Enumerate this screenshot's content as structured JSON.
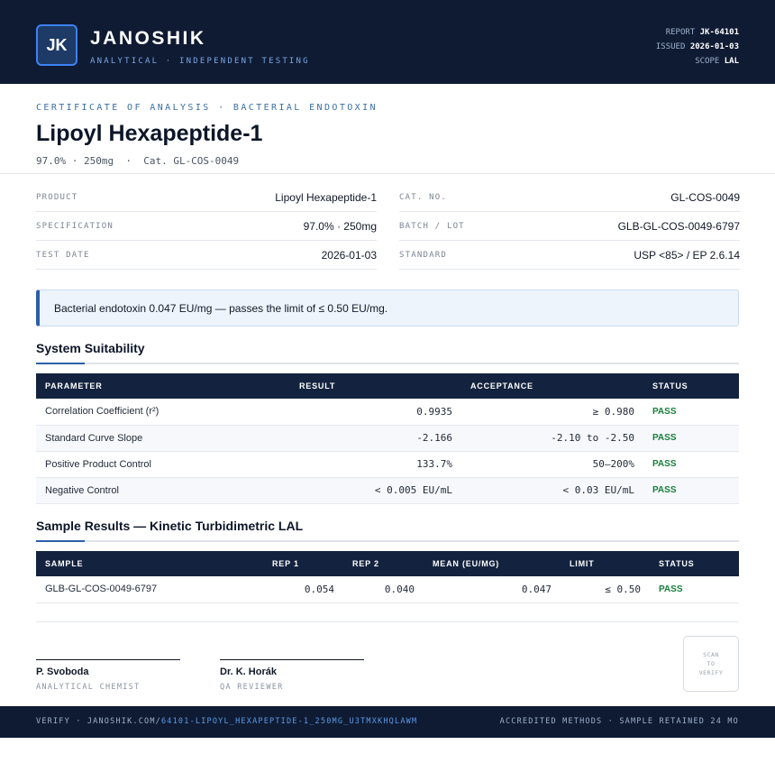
{
  "header": {
    "logo_text": "JK",
    "brand_name": "JANOSHIK",
    "tagline": "ANALYTICAL · INDEPENDENT TESTING",
    "report_label": "REPORT",
    "report_value": "JK-64101",
    "issued_label": "ISSUED",
    "issued_value": "2026-01-03",
    "scope_label": "SCOPE",
    "scope_value": "LAL"
  },
  "doc": {
    "kicker": "CERTIFICATE OF ANALYSIS · BACTERIAL ENDOTOXIN",
    "title": "Lipoyl Hexapeptide-1",
    "subtitle": "97.0% · 250mg  ·  Cat. GL-COS-0049"
  },
  "info": {
    "left": [
      {
        "label": "PRODUCT",
        "value": "Lipoyl Hexapeptide-1"
      },
      {
        "label": "SPECIFICATION",
        "value": "97.0% · 250mg"
      },
      {
        "label": "TEST DATE",
        "value": "2026-01-03"
      }
    ],
    "right": [
      {
        "label": "CAT. NO.",
        "value": "GL-COS-0049"
      },
      {
        "label": "BATCH / LOT",
        "value": "GLB-GL-COS-0049-6797"
      },
      {
        "label": "STANDARD",
        "value": "USP <85> / EP 2.6.14"
      }
    ]
  },
  "notice": "Bacterial endotoxin 0.047 EU/mg — passes the limit of ≤ 0.50 EU/mg.",
  "system": {
    "title": "System Suitability",
    "headers": [
      "PARAMETER",
      "RESULT",
      "ACCEPTANCE",
      "STATUS"
    ],
    "rows": [
      {
        "parameter": "Correlation Coefficient (r²)",
        "result": "0.9935",
        "acceptance": "≥ 0.980",
        "status": "PASS"
      },
      {
        "parameter": "Standard Curve Slope",
        "result": "-2.166",
        "acceptance": "-2.10 to -2.50",
        "status": "PASS"
      },
      {
        "parameter": "Positive Product Control",
        "result": "133.7%",
        "acceptance": "50–200%",
        "status": "PASS"
      },
      {
        "parameter": "Negative Control",
        "result": "< 0.005 EU/mL",
        "acceptance": "< 0.03 EU/mL",
        "status": "PASS"
      }
    ]
  },
  "samples": {
    "title": "Sample Results — Kinetic Turbidimetric LAL",
    "headers": [
      "SAMPLE",
      "REP 1",
      "REP 2",
      "MEAN (EU/MG)",
      "LIMIT",
      "STATUS"
    ],
    "rows": [
      {
        "sample": "GLB-GL-COS-0049-6797",
        "rep1": "0.054",
        "rep2": "0.040",
        "mean": "0.047",
        "limit": "≤ 0.50",
        "status": "PASS"
      }
    ]
  },
  "signatures": [
    {
      "name": "P. Svoboda",
      "role": "ANALYTICAL CHEMIST"
    },
    {
      "name": "Dr. K. Horák",
      "role": "QA REVIEWER"
    }
  ],
  "qr": {
    "line1": "SCAN",
    "line2": "TO",
    "line3": "VERIFY"
  },
  "footer": {
    "verify_prefix": "VERIFY · JANOSHIK.COM/",
    "verify_path": "64101-LIPOYL_HEXAPEPTIDE-1_250MG_U3TMXKHQLAWM",
    "right_text": "ACCREDITED METHODS · SAMPLE RETAINED 24 MO"
  }
}
